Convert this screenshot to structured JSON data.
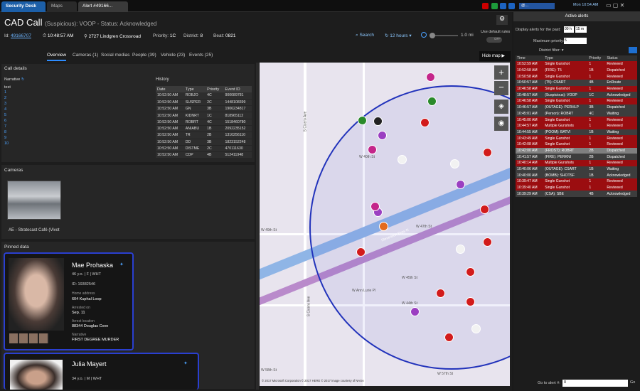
{
  "tabs": {
    "security_desk": "Security Desk",
    "maps": "Maps",
    "alert": "Alert #49166..."
  },
  "tray": {
    "time": "Mon 10:54 AM",
    "user": "@..."
  },
  "header": {
    "title": "CAD Call",
    "subtitle": "(Suspicious): VOOP - Status: Acknowledged",
    "id_label": "Id:",
    "id_value": "49166707",
    "time": "10:48:57 AM",
    "address": "2727 Lindgren Crossroad",
    "priority_label": "Priority:",
    "priority_value": "1C",
    "district_label": "District:",
    "district_value": "8",
    "beat_label": "Beat:",
    "beat_value": "0821"
  },
  "controls": {
    "search": "Search",
    "hours": "12 hours",
    "distance": "1.0 mi",
    "default_rules": "Use default rules",
    "toggle": "OFF",
    "hide_map": "Hide map"
  },
  "subtabs": [
    "Overview",
    "Cameras (1)",
    "Social medias",
    "People (39)",
    "Vehicle (23)",
    "Events (25)"
  ],
  "call_details": {
    "title": "Call details",
    "narrative": "Narrative",
    "text_label": "test",
    "line_numbers": [
      "1",
      "2",
      "3",
      "4",
      "5",
      "6",
      "7",
      "8",
      "9",
      "10"
    ]
  },
  "history": {
    "title": "History",
    "columns": [
      "Date",
      "Type",
      "Priority",
      "Event ID"
    ],
    "rows": [
      [
        "10:52:50 AM",
        "ROBJO",
        "4C",
        "900089781"
      ],
      [
        "10:52:50 AM",
        "SUSPER",
        "2C",
        "1448108399"
      ],
      [
        "10:52:50 AM",
        "GN",
        "3B",
        "1906234817"
      ],
      [
        "10:52:50 AM",
        "KIDNRT",
        "1C",
        "818965112"
      ],
      [
        "10:52:50 AM",
        "ROBRT",
        "4C",
        "1518460780"
      ],
      [
        "10:52:50 AM",
        "ANIABU",
        "1B",
        "2092235152"
      ],
      [
        "10:52:50 AM",
        "TR",
        "2B",
        "1310256110"
      ],
      [
        "10:52:50 AM",
        "DD",
        "3B",
        "1823152248"
      ],
      [
        "10:52:50 AM",
        "DISTME",
        "2C",
        "470111630"
      ],
      [
        "10:52:50 AM",
        "CDP",
        "4B",
        "512411948"
      ]
    ]
  },
  "cameras": {
    "title": "Cameras",
    "name": "AE - Stratocast Café (Vivot"
  },
  "pinned": {
    "title": "Pinned data",
    "p1": {
      "name": "Mae Prohaska",
      "info": "46 y.o.  |  F  |  WHT",
      "id": "ID: 19382546",
      "home_label": "Home address",
      "home": "604 Kuphal Loop",
      "arrest_label": "Arrested on",
      "arrest": "Sep. 11",
      "arrest_loc_label": "Arrest location",
      "arrest_loc": "88344 Douglas Cove",
      "narr_label": "Narrative",
      "narr": "FIRST DEGREE MURDER"
    },
    "p2": {
      "name": "Julia Mayert",
      "info": "34 y.o.  |  M  |  WHT"
    }
  },
  "map": {
    "streets": [
      "S Cicero Ave",
      "S Cicero Ave",
      "W 49th St",
      "W 44th St",
      "W 45th St",
      "W 47th St",
      "W Ann Lurie Pl",
      "Stevenson Expy N",
      "W 58th St",
      "W 57th St",
      "W 40th St"
    ],
    "copyright": "© 2017 Microsoft Corporation © 2017 HERE © 2017 image courtesy of NASA"
  },
  "alerts": {
    "title": "Active alerts",
    "past_label": "Display alerts for the past:",
    "past_h": "00 h",
    "past_m": "15 m",
    "maxprio_label": "Maximum priority:",
    "maxprio": "5",
    "district_label": "District filter:",
    "columns": [
      "Time",
      "Type",
      "Priority",
      "Status"
    ],
    "rows": [
      [
        "10:52:59 AM",
        "Single Gunshot",
        "1",
        "Reviewed",
        "red"
      ],
      [
        "10:52:58 AM",
        "(FIRE): T5",
        "1B",
        "Dispatched",
        "red"
      ],
      [
        "10:50:58 AM",
        "Single Gunshot",
        "1",
        "Reviewed",
        "red"
      ],
      [
        "10:50:57 AM",
        "(T5): CSART",
        "4B",
        "EnRoute",
        "grey"
      ],
      [
        "10:46:58 AM",
        "Single Gunshot",
        "1",
        "Reviewed",
        "red"
      ],
      [
        "10:48:57 AM",
        "(Suspicious): VOOP",
        "1C",
        "Acknowledged",
        "grey"
      ],
      [
        "10:46:58 AM",
        "Single Gunshot",
        "1",
        "Reviewed",
        "red"
      ],
      [
        "10:46:57 AM",
        "(OUTAGE): PERHLP",
        "3B",
        "Dispatched",
        "grey"
      ],
      [
        "10:45:01 AM",
        "(Person): ROBRT",
        "4C",
        "Waiting",
        "grey"
      ],
      [
        "10:45:00 AM",
        "Single Gunshot",
        "1",
        "Reviewed",
        "red"
      ],
      [
        "10:44:57 AM",
        "Multiple Gunshots",
        "1",
        "Reviewed",
        "red"
      ],
      [
        "10:44:55 AM",
        "(POOM): BATVI",
        "1B",
        "Waiting",
        "grey"
      ],
      [
        "10:43:49 AM",
        "Single Gunshot",
        "1",
        "Reviewed",
        "red"
      ],
      [
        "10:42:08 AM",
        "Single Gunshot",
        "1",
        "Reviewed",
        "red"
      ],
      [
        "10:42:00 AM",
        "(FROST): ROBRT",
        "2B",
        "Dispatched",
        "sel"
      ],
      [
        "10:41:57 AM",
        "(FIRE): PERKNI",
        "2B",
        "Dispatched",
        "grey"
      ],
      [
        "10:40:14 AM",
        "Multiple Gunshots",
        "1",
        "Reviewed",
        "red"
      ],
      [
        "10:40:06 AM",
        "(OUTAGE): CSART",
        "1B",
        "Waiting",
        "grey"
      ],
      [
        "10:40:00 AM",
        "(BOMB): SHOTSF",
        "1B",
        "Acknowledged",
        "grey"
      ],
      [
        "10:39:47 AM",
        "Single Gunshot",
        "1",
        "Reviewed",
        "red"
      ],
      [
        "10:39:40 AM",
        "Single Gunshot",
        "1",
        "Reviewed",
        "red"
      ],
      [
        "10:39:29 AM",
        "(CSA): SBE",
        "4B",
        "Acknowledged",
        "grey"
      ]
    ],
    "goto_label": "Go to alert #:",
    "goto_value": "0",
    "go": "Go"
  }
}
